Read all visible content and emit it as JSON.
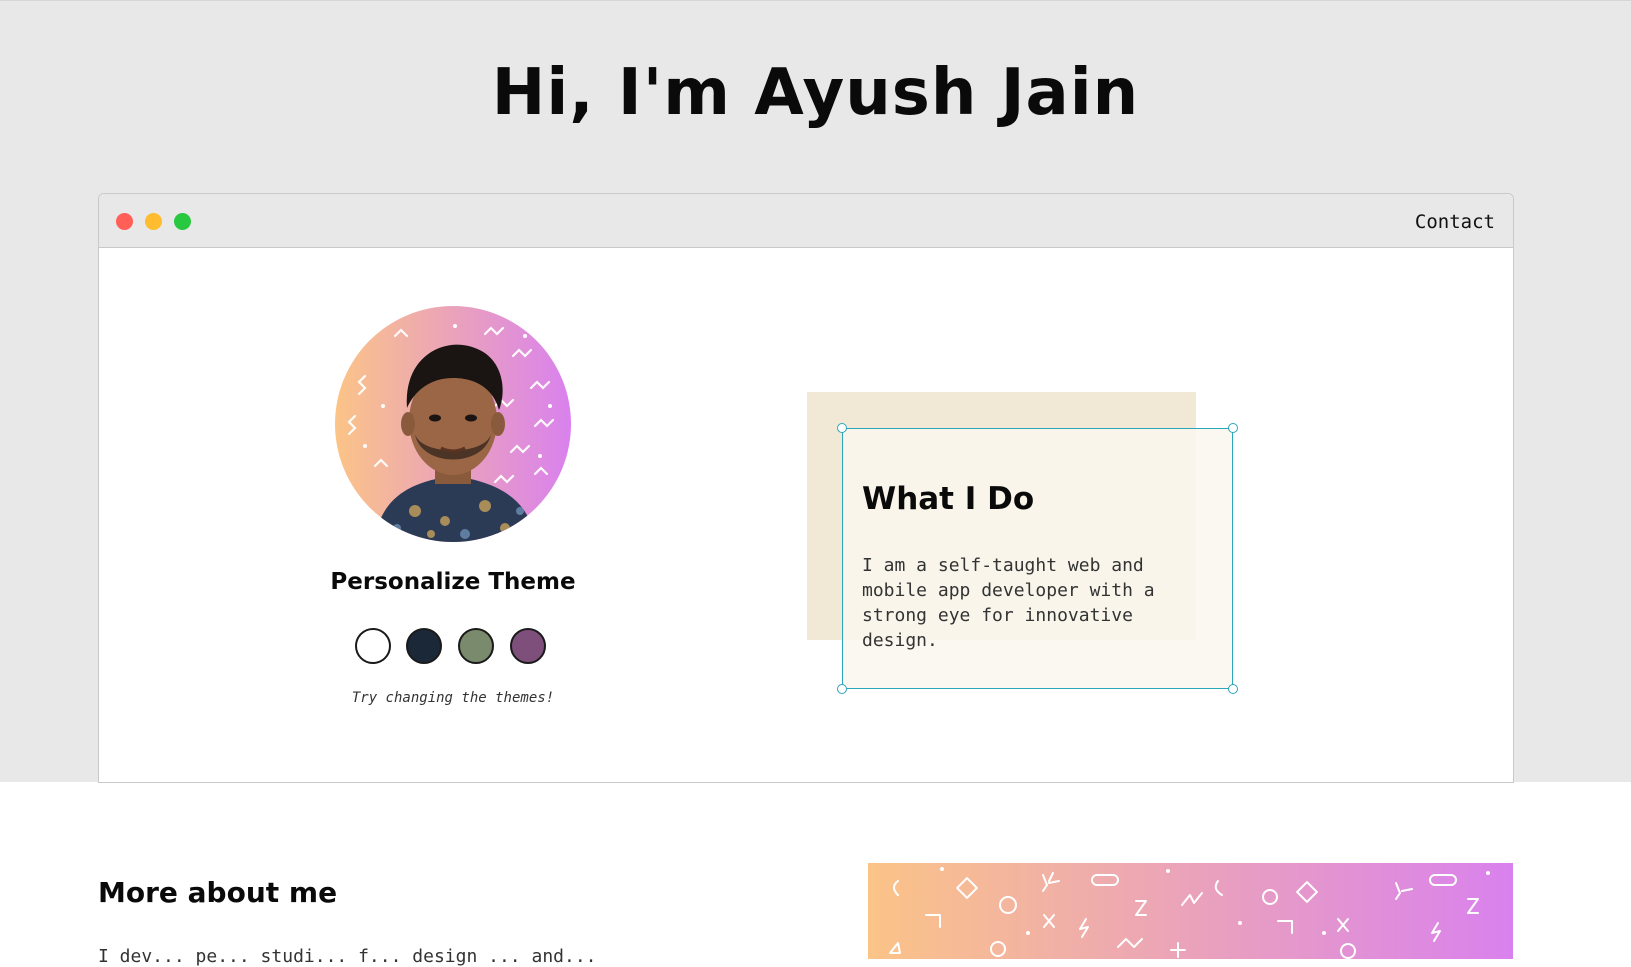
{
  "header": {
    "title": "Hi, I'm Ayush Jain"
  },
  "window": {
    "nav_contact": "Contact",
    "controls": [
      "close",
      "minimize",
      "maximize"
    ]
  },
  "profile": {
    "avatar_icon": "profile-photo",
    "theme_heading": "Personalize Theme",
    "theme_options": [
      {
        "name": "light",
        "color": "#ffffff"
      },
      {
        "name": "dark-blue",
        "color": "#1b2838"
      },
      {
        "name": "green",
        "color": "#7a8a6c"
      },
      {
        "name": "purple",
        "color": "#7e4f7a"
      }
    ],
    "theme_hint": "Try changing the themes!"
  },
  "what_i_do": {
    "title": "What I Do",
    "text": "I am a self-taught web and mobile app developer with a strong eye for innovative design."
  },
  "more_about": {
    "title": "More about me",
    "text": "I dev... pe... studi... f... design ... and... "
  },
  "colors": {
    "hero_bg": "#e8e8e8",
    "accent": "#2aa6bd",
    "gradient_start": "#fbc487",
    "gradient_end": "#d981ee"
  }
}
